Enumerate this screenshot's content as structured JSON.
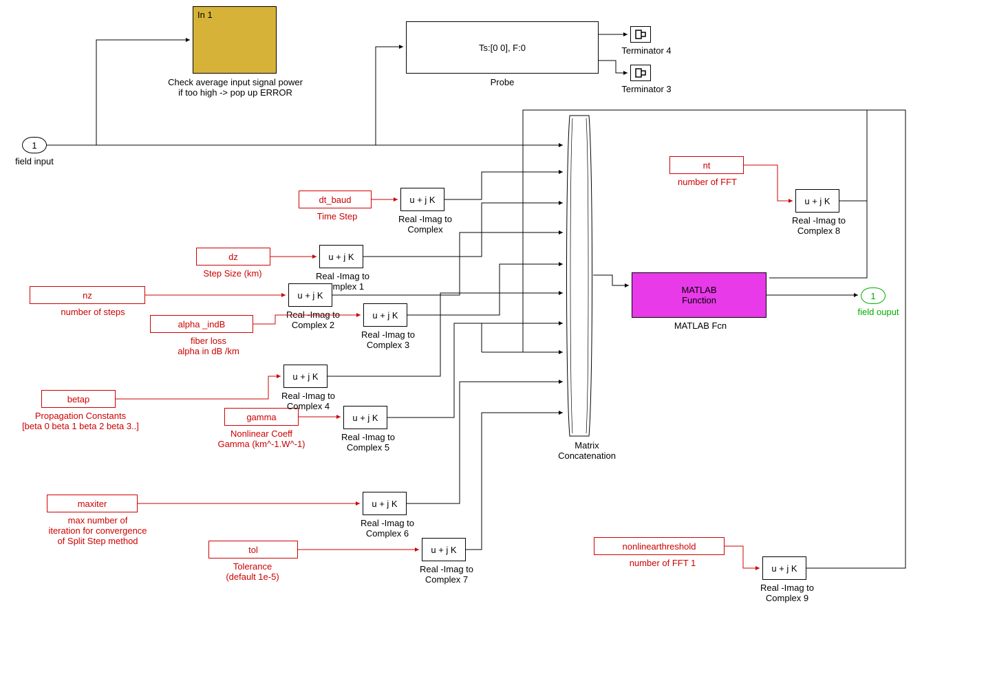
{
  "input_port": {
    "number": "1",
    "label": "field input"
  },
  "check_block": {
    "text": "In 1",
    "label": "Check average input signal power\nif too high  -> pop up ERROR"
  },
  "probe": {
    "text": "Ts:[0 0], F:0",
    "label": "Probe"
  },
  "terminator4": {
    "label": "Terminator 4"
  },
  "terminator3": {
    "label": "Terminator 3"
  },
  "const_dt": {
    "text": "dt_baud",
    "label": "Time Step"
  },
  "const_dz": {
    "text": "dz",
    "label": "Step Size  (km)"
  },
  "const_nz": {
    "text": "nz",
    "label": "number of steps"
  },
  "const_alpha": {
    "text": "alpha _indB",
    "label": "fiber loss\nalpha in dB  /km"
  },
  "const_betap": {
    "text": "betap",
    "label": "Propagation Constants\n[beta 0 beta 1 beta 2 beta 3..]"
  },
  "const_gamma": {
    "text": "gamma",
    "label": "Nonlinear Coeff\nGamma  (km^-1.W^-1)"
  },
  "const_maxiter": {
    "text": "maxiter",
    "label": "max number of\niteration for convergence\nof Split Step method"
  },
  "const_tol": {
    "text": "tol",
    "label": "Tolerance\n(default  1e-5)"
  },
  "const_nt": {
    "text": "nt",
    "label": "number of FFT"
  },
  "const_nlt": {
    "text": "nonlinearthreshold",
    "label": "number of FFT 1"
  },
  "ri2c": {
    "text": "u + j K",
    "label_base": "Real -Imag to\nComplex"
  },
  "ri2c1": {
    "label": "Real -Imag to\nComplex 1"
  },
  "ri2c2": {
    "label": "Real -Imag to\nComplex 2"
  },
  "ri2c3": {
    "label": "Real -Imag to\nComplex 3"
  },
  "ri2c4": {
    "label": "Real -Imag to\nComplex 4"
  },
  "ri2c5": {
    "label": "Real -Imag to\nComplex 5"
  },
  "ri2c6": {
    "label": "Real -Imag to\nComplex 6"
  },
  "ri2c7": {
    "label": "Real -Imag to\nComplex 7"
  },
  "ri2c8": {
    "label": "Real -Imag to\nComplex 8"
  },
  "ri2c9": {
    "label": "Real -Imag to\nComplex 9"
  },
  "matrix_concat": {
    "label": "Matrix\nConcatenation"
  },
  "matlab_fcn": {
    "text": "MATLAB\nFunction",
    "label": "MATLAB Fcn"
  },
  "output_port": {
    "number": "1",
    "label": "field ouput"
  }
}
